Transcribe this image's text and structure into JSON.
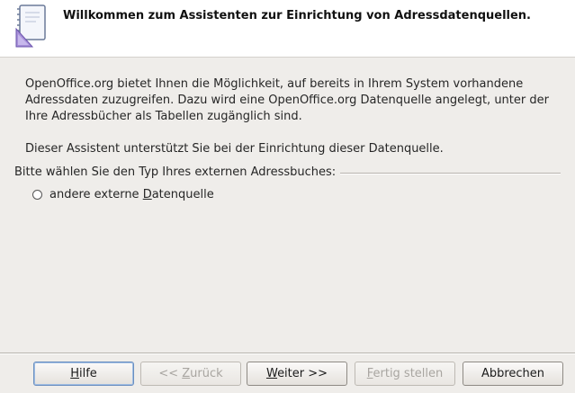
{
  "header": {
    "title": "Willkommen zum Assistenten zur Einrichtung von Adressdatenquellen.",
    "icon": "address-book-wizard-icon"
  },
  "intro": {
    "paragraph1": "OpenOffice.org bietet Ihnen die Möglichkeit, auf bereits in Ihrem System vorhandene Adressdaten zuzugreifen. Dazu wird eine OpenOffice.org Datenquelle angelegt, unter der Ihre Adressbücher als Tabellen zugänglich sind.",
    "paragraph2": "Dieser Assistent unterstützt Sie bei der Einrichtung dieser Datenquelle."
  },
  "type_group": {
    "label": "Bitte wählen Sie den Typ Ihres externen Adressbuches:",
    "options": [
      {
        "label_pre": "andere externe ",
        "label_mnemonic": "D",
        "label_post": "atenquelle",
        "selected": false
      }
    ]
  },
  "buttons": {
    "help": {
      "mnemonic": "H",
      "rest": "ilfe"
    },
    "back": {
      "pre": "<< ",
      "mnemonic": "Z",
      "rest": "urück",
      "enabled": false
    },
    "next": {
      "mnemonic": "W",
      "rest": "eiter >>",
      "enabled": true
    },
    "finish": {
      "mnemonic": "F",
      "rest": "ertig stellen",
      "enabled": false
    },
    "cancel": {
      "label": "Abbrechen"
    }
  }
}
